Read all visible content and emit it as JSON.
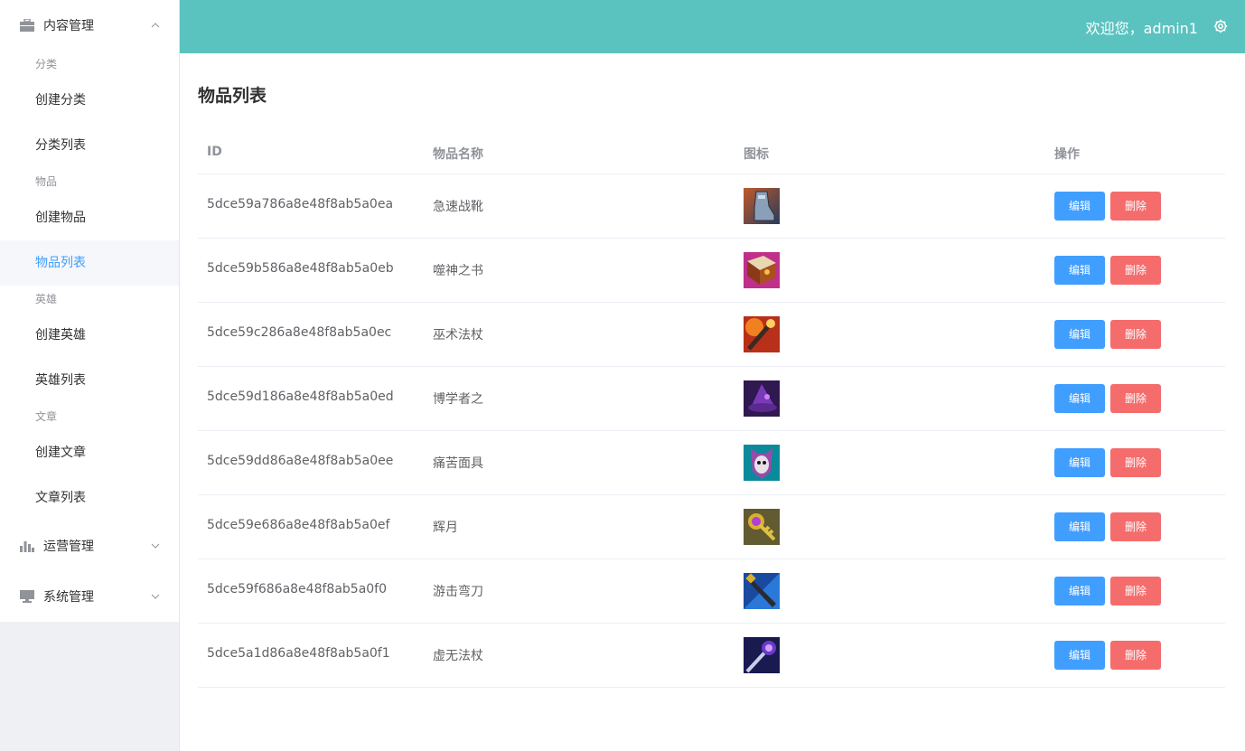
{
  "header": {
    "welcome": "欢迎您，admin1",
    "accent": "#5ac2bf"
  },
  "sidebar": {
    "sections": [
      {
        "title": "内容管理",
        "icon": "briefcase-icon",
        "expanded": true
      },
      {
        "title": "运营管理",
        "icon": "bar-chart-icon",
        "expanded": false
      },
      {
        "title": "系统管理",
        "icon": "monitor-icon",
        "expanded": false
      }
    ],
    "groups": [
      {
        "title": "分类",
        "items": [
          "创建分类",
          "分类列表"
        ]
      },
      {
        "title": "物品",
        "items": [
          "创建物品",
          "物品列表"
        ]
      },
      {
        "title": "英雄",
        "items": [
          "创建英雄",
          "英雄列表"
        ]
      },
      {
        "title": "文章",
        "items": [
          "创建文章",
          "文章列表"
        ]
      }
    ],
    "active_item": "物品列表",
    "active_color": "#409eff"
  },
  "main": {
    "title": "物品列表",
    "columns": [
      "ID",
      "物品名称",
      "图标",
      "操作"
    ],
    "rows": [
      {
        "id": "5dce59a786a8e48f8ab5a0ea",
        "name": "急速战靴",
        "icon": "boots-icon"
      },
      {
        "id": "5dce59b586a8e48f8ab5a0eb",
        "name": "噬神之书",
        "icon": "book-icon"
      },
      {
        "id": "5dce59c286a8e48f8ab5a0ec",
        "name": "巫术法杖",
        "icon": "staff-icon"
      },
      {
        "id": "5dce59d186a8e48f8ab5a0ed",
        "name": "博学者之",
        "icon": "hat-icon"
      },
      {
        "id": "5dce59dd86a8e48f8ab5a0ee",
        "name": "痛苦面具",
        "icon": "mask-icon"
      },
      {
        "id": "5dce59e686a8e48f8ab5a0ef",
        "name": "辉月",
        "icon": "moon-key-icon"
      },
      {
        "id": "5dce59f686a8e48f8ab5a0f0",
        "name": "游击弯刀",
        "icon": "blade-icon"
      },
      {
        "id": "5dce5a1d86a8e48f8ab5a0f1",
        "name": "虚无法杖",
        "icon": "void-staff-icon"
      }
    ],
    "edit_label": "编辑",
    "delete_label": "删除",
    "edit_color": "#409eff",
    "delete_color": "#f56c6c"
  }
}
